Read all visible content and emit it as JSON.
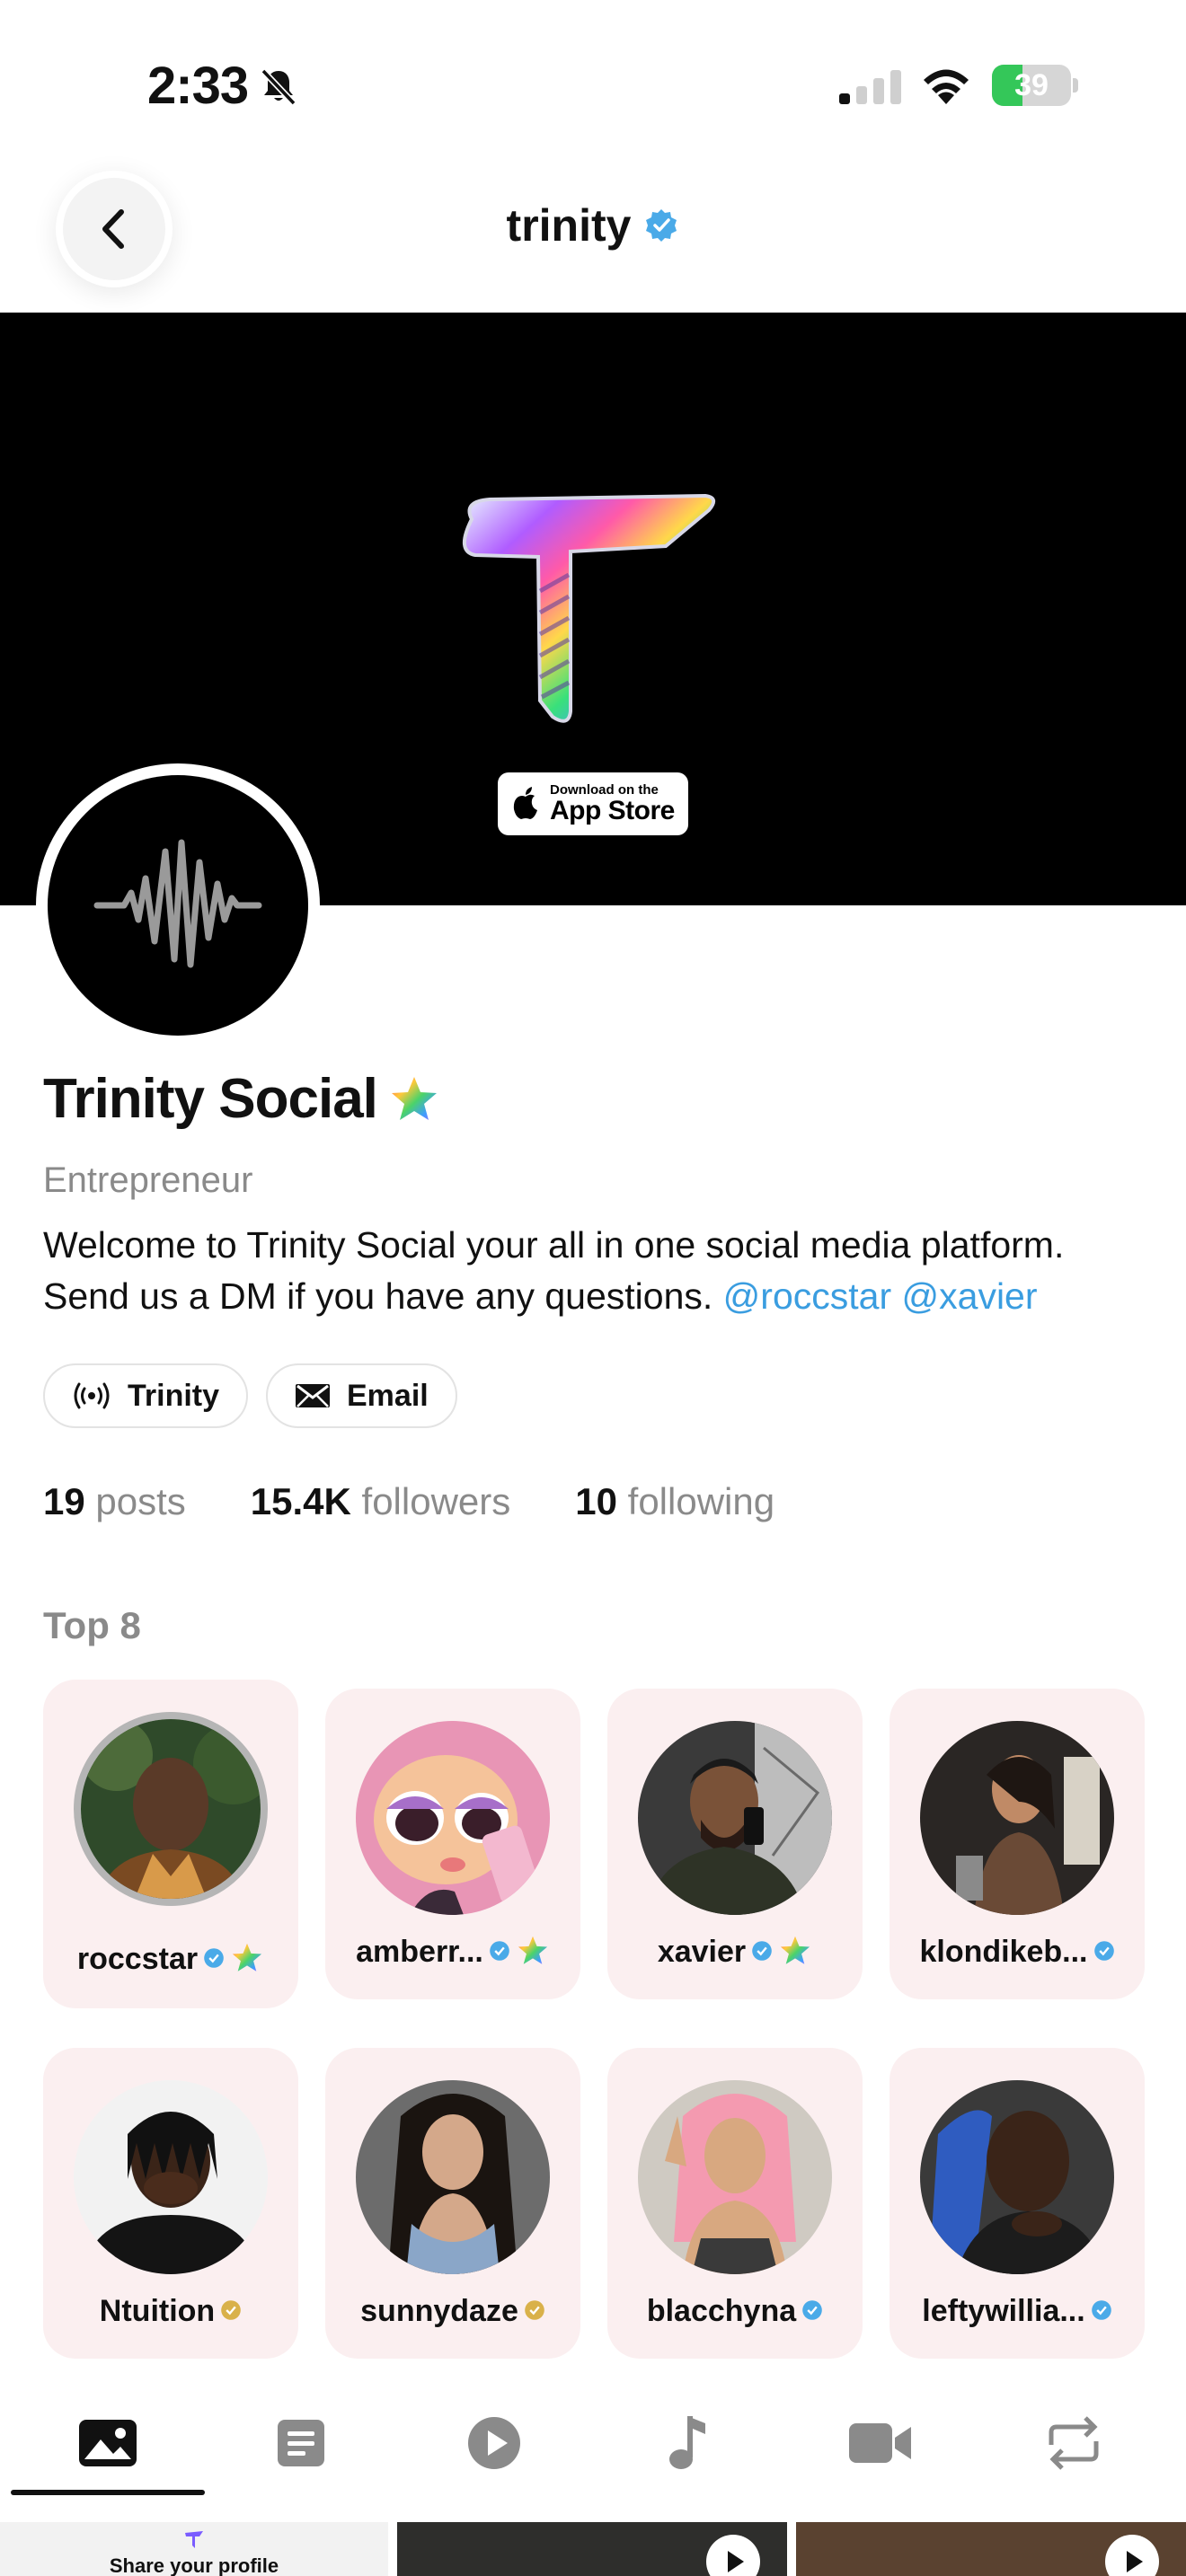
{
  "status_bar": {
    "time": "2:33",
    "battery_percent": "39",
    "battery_level": 0.39,
    "signal_bars": 1
  },
  "header": {
    "title": "trinity",
    "verified": true
  },
  "banner": {
    "app_store_small": "Download on the",
    "app_store_big": "App Store"
  },
  "profile": {
    "display_name": "Trinity Social",
    "role": "Entrepreneur",
    "bio_text": "Welcome to Trinity Social your all in one social media platform. Send us a DM if you have any questions. ",
    "mentions": [
      "@roccstar",
      "@xavier"
    ]
  },
  "links": [
    {
      "label": "Trinity",
      "icon": "broadcast-icon"
    },
    {
      "label": "Email",
      "icon": "envelope-icon"
    }
  ],
  "stats": [
    {
      "value": "19",
      "label": "posts"
    },
    {
      "value": "15.4K",
      "label": "followers"
    },
    {
      "value": "10",
      "label": "following"
    }
  ],
  "top8": {
    "heading": "Top 8",
    "users": [
      {
        "name": "roccstar",
        "badge": "blue",
        "star": true
      },
      {
        "name": "amberr...",
        "badge": "blue",
        "star": true
      },
      {
        "name": "xavier",
        "badge": "blue",
        "star": true
      },
      {
        "name": "klondikeb...",
        "badge": "blue",
        "star": false
      },
      {
        "name": "Ntuition",
        "badge": "gold",
        "star": false
      },
      {
        "name": "sunnydaze",
        "badge": "gold",
        "star": false
      },
      {
        "name": "blacchyna",
        "badge": "blue",
        "star": false
      },
      {
        "name": "leftywillia...",
        "badge": "blue",
        "star": false
      }
    ]
  },
  "tabs": [
    "photos-icon",
    "notes-icon",
    "play-icon",
    "music-icon",
    "video-icon",
    "repost-icon"
  ],
  "grid": {
    "share_text": "Share your profile"
  },
  "colors": {
    "accent": "#3a9de0",
    "verified_blue": "#4aaae8",
    "verified_gold": "#d9b14a",
    "card_bg": "#fbeff0"
  }
}
